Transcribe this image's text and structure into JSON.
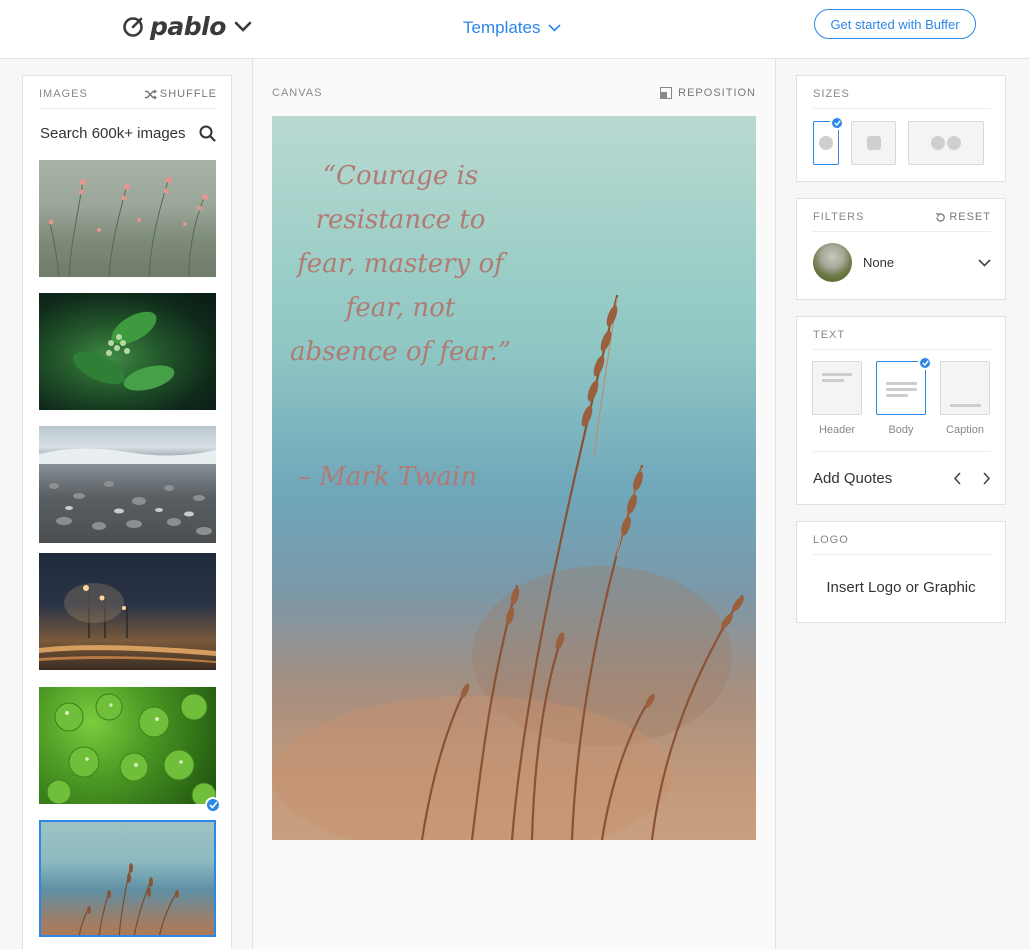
{
  "header": {
    "brand": "pablo",
    "templates_label": "Templates",
    "cta_label": "Get started with Buffer"
  },
  "images_panel": {
    "title": "IMAGES",
    "shuffle_label": "SHUFFLE",
    "search_placeholder": "Search 600k+ images",
    "thumbnails": [
      {
        "name": "pink-wildflowers",
        "selected": false
      },
      {
        "name": "green-plant-buds",
        "selected": false
      },
      {
        "name": "pebble-beach-waves",
        "selected": false
      },
      {
        "name": "night-street-lights",
        "selected": false
      },
      {
        "name": "clover-leaves-dew",
        "selected": false
      },
      {
        "name": "wheat-grass-blue-sky",
        "selected": true
      }
    ]
  },
  "canvas": {
    "title": "CANVAS",
    "reposition_label": "REPOSITION",
    "quote": "“Courage is resistance to fear, mastery of fear, not absence of fear.”",
    "author": "– Mark Twain"
  },
  "sizes": {
    "title": "SIZES",
    "options": [
      {
        "name": "pinterest",
        "selected": true
      },
      {
        "name": "instagram",
        "selected": false
      },
      {
        "name": "facebook-twitter",
        "selected": false
      }
    ]
  },
  "filters": {
    "title": "FILTERS",
    "reset_label": "RESET",
    "selected": "None"
  },
  "text": {
    "title": "TEXT",
    "styles": [
      {
        "label": "Header",
        "selected": false
      },
      {
        "label": "Body",
        "selected": true
      },
      {
        "label": "Caption",
        "selected": false
      }
    ],
    "add_quotes_label": "Add Quotes"
  },
  "logo": {
    "title": "LOGO",
    "insert_label": "Insert Logo or Graphic"
  },
  "colors": {
    "accent": "#2c87e6",
    "quote_text": "#b07b73"
  }
}
